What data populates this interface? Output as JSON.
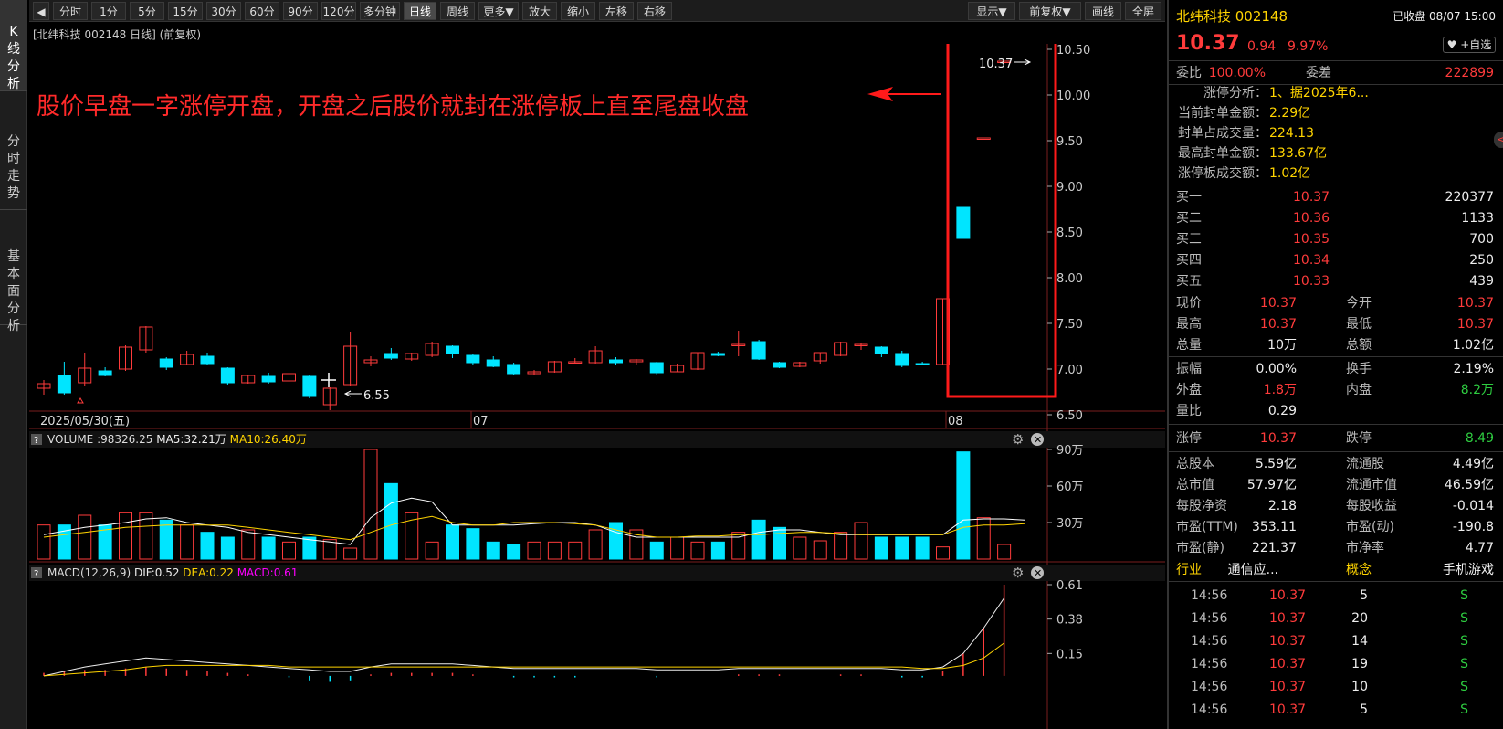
{
  "window": {
    "back_icon": "back-arrow-icon"
  },
  "toolbar": {
    "items": [
      "分时",
      "1分",
      "5分",
      "15分",
      "30分",
      "60分",
      "90分",
      "120分",
      "多分钟",
      "日线",
      "周线",
      "更多▼",
      "放大",
      "缩小",
      "左移",
      "右移"
    ],
    "active": "日线",
    "right_items": [
      "显示▼",
      "前复权▼",
      "画线",
      "全屏"
    ]
  },
  "side_tabs": [
    {
      "label": "K线分析",
      "active": true
    },
    {
      "label": "分时走势",
      "active": false
    },
    {
      "label": "基本面分析",
      "active": false
    }
  ],
  "kline": {
    "title": "[北纬科技 002148 日线]",
    "adjust": "(前复权)",
    "annotation": "股价早盘一字涨停开盘，开盘之后股价就封在涨停板上直至尾盘收盘",
    "high_label": "10.37",
    "low_label": "6.55",
    "date_label": "2025/05/30(五)",
    "month_labels": [
      "07",
      "08"
    ],
    "y_ticks": [
      "10.50",
      "10.00",
      "9.50",
      "9.00",
      "8.50",
      "8.00",
      "7.50",
      "7.00",
      "6.50"
    ]
  },
  "volume": {
    "label": "VOLUME",
    "value": ":98326.25",
    "ma5": "MA5:32.21万",
    "ma10": "MA10:26.40万",
    "y_ticks": [
      "90万",
      "60万",
      "30万"
    ]
  },
  "macd": {
    "label": "MACD(12,26,9)",
    "dif": "DIF:0.52",
    "dea": "DEA:0.22",
    "macd": "MACD:0.61",
    "y_ticks": [
      "0.61",
      "0.38",
      "0.15"
    ]
  },
  "chart_data": {
    "type": "candlestick",
    "candles": [
      [
        6.79,
        6.84,
        6.72,
        6.88
      ],
      [
        6.93,
        6.74,
        6.72,
        7.08
      ],
      [
        6.85,
        7.01,
        6.82,
        7.18
      ],
      [
        6.98,
        6.93,
        6.92,
        7.02
      ],
      [
        7.0,
        7.24,
        6.98,
        7.26
      ],
      [
        7.21,
        7.46,
        7.18,
        7.47
      ],
      [
        7.11,
        7.02,
        6.99,
        7.13
      ],
      [
        7.05,
        7.16,
        7.04,
        7.2
      ],
      [
        7.14,
        7.06,
        7.04,
        7.18
      ],
      [
        7.01,
        6.85,
        6.83,
        7.02
      ],
      [
        6.85,
        6.93,
        6.84,
        6.94
      ],
      [
        6.92,
        6.86,
        6.84,
        6.96
      ],
      [
        6.87,
        6.95,
        6.84,
        6.98
      ],
      [
        6.92,
        6.7,
        6.68,
        6.93
      ],
      [
        6.61,
        6.79,
        6.55,
        6.8
      ],
      [
        6.83,
        7.25,
        6.82,
        7.41
      ],
      [
        7.07,
        7.1,
        7.03,
        7.14
      ],
      [
        7.17,
        7.12,
        7.1,
        7.23
      ],
      [
        7.11,
        7.17,
        7.09,
        7.18
      ],
      [
        7.15,
        7.28,
        7.13,
        7.3
      ],
      [
        7.25,
        7.17,
        7.12,
        7.26
      ],
      [
        7.15,
        7.07,
        7.05,
        7.17
      ],
      [
        7.1,
        7.03,
        7.02,
        7.14
      ],
      [
        7.05,
        6.95,
        6.94,
        7.07
      ],
      [
        6.95,
        6.97,
        6.93,
        6.99
      ],
      [
        6.97,
        7.08,
        6.96,
        7.09
      ],
      [
        7.08,
        7.08,
        7.06,
        7.12
      ],
      [
        7.07,
        7.2,
        7.06,
        7.25
      ],
      [
        7.1,
        7.07,
        7.05,
        7.13
      ],
      [
        7.08,
        7.1,
        7.05,
        7.11
      ],
      [
        7.07,
        6.96,
        6.94,
        7.08
      ],
      [
        6.97,
        7.04,
        6.97,
        7.06
      ],
      [
        7.0,
        7.18,
        6.99,
        7.18
      ],
      [
        7.17,
        7.15,
        7.14,
        7.19
      ],
      [
        7.26,
        7.27,
        7.14,
        7.42
      ],
      [
        7.3,
        7.11,
        7.1,
        7.32
      ],
      [
        7.07,
        7.02,
        7.01,
        7.08
      ],
      [
        7.03,
        7.07,
        7.02,
        7.08
      ],
      [
        7.09,
        7.18,
        7.06,
        7.18
      ],
      [
        7.15,
        7.29,
        7.14,
        7.3
      ],
      [
        7.26,
        7.27,
        7.21,
        7.28
      ],
      [
        7.24,
        7.17,
        7.13,
        7.25
      ],
      [
        7.17,
        7.04,
        7.02,
        7.2
      ],
      [
        7.06,
        7.05,
        7.04,
        7.08
      ],
      [
        7.05,
        7.77,
        7.05,
        7.77
      ],
      [
        8.77,
        8.43,
        8.43,
        8.77
      ],
      [
        9.53,
        9.53,
        9.53,
        9.53
      ],
      [
        10.37,
        10.37,
        10.37,
        10.37
      ]
    ],
    "volume": [
      28,
      28,
      36,
      28,
      38,
      38,
      32,
      28,
      22,
      18,
      24,
      18,
      14,
      18,
      16,
      9,
      90,
      62,
      38,
      14,
      28,
      25,
      14,
      12,
      14,
      14,
      14,
      24,
      30,
      24,
      14,
      18,
      14,
      14,
      22,
      32,
      26,
      18,
      15,
      22,
      30,
      18,
      18,
      18,
      10,
      88,
      34,
      12,
      7
    ],
    "ma5": [
      20,
      23,
      26,
      28,
      30,
      33,
      34,
      30,
      28,
      26,
      22,
      20,
      18,
      16,
      14,
      12,
      34,
      46,
      50,
      47,
      28,
      28,
      28,
      28,
      29,
      30,
      30,
      28,
      22,
      18,
      18,
      18,
      18,
      18,
      18,
      22,
      24,
      24,
      22,
      20,
      20,
      20,
      20,
      20,
      20,
      32,
      33,
      33,
      32
    ],
    "ma10": [
      18,
      20,
      22,
      24,
      26,
      27,
      28,
      28,
      28,
      28,
      26,
      24,
      22,
      20,
      18,
      16,
      22,
      28,
      32,
      35,
      30,
      28,
      28,
      30,
      30,
      30,
      29,
      28,
      24,
      20,
      18,
      18,
      19,
      19,
      20,
      20,
      21,
      22,
      22,
      21,
      20,
      20,
      20,
      20,
      20,
      26,
      28,
      28,
      29
    ],
    "macd_hist": [
      0.02,
      0.03,
      0.04,
      0.04,
      0.05,
      0.06,
      0.05,
      0.04,
      0.03,
      0.02,
      0.01,
      0.0,
      -0.01,
      -0.03,
      -0.04,
      -0.03,
      0.01,
      0.02,
      0.02,
      0.02,
      0.02,
      0.01,
      0.0,
      -0.01,
      -0.01,
      -0.01,
      -0.01,
      0.0,
      0.0,
      0.0,
      -0.01,
      0.0,
      0.0,
      0.0,
      0.01,
      0.01,
      0.01,
      0.0,
      0.0,
      0.01,
      0.01,
      0.0,
      -0.01,
      -0.01,
      0.03,
      0.15,
      0.32,
      0.61
    ],
    "dif": [
      0.0,
      0.03,
      0.06,
      0.08,
      0.1,
      0.12,
      0.11,
      0.1,
      0.09,
      0.08,
      0.07,
      0.06,
      0.05,
      0.04,
      0.03,
      0.03,
      0.06,
      0.08,
      0.08,
      0.08,
      0.08,
      0.07,
      0.06,
      0.05,
      0.05,
      0.05,
      0.05,
      0.05,
      0.05,
      0.05,
      0.04,
      0.04,
      0.04,
      0.04,
      0.05,
      0.05,
      0.05,
      0.05,
      0.05,
      0.05,
      0.05,
      0.05,
      0.04,
      0.04,
      0.06,
      0.15,
      0.32,
      0.52
    ],
    "dea": [
      0.0,
      0.01,
      0.02,
      0.03,
      0.04,
      0.06,
      0.07,
      0.07,
      0.07,
      0.07,
      0.07,
      0.07,
      0.06,
      0.06,
      0.06,
      0.06,
      0.06,
      0.06,
      0.06,
      0.06,
      0.06,
      0.06,
      0.06,
      0.06,
      0.06,
      0.06,
      0.06,
      0.06,
      0.06,
      0.06,
      0.06,
      0.06,
      0.06,
      0.06,
      0.06,
      0.06,
      0.06,
      0.06,
      0.06,
      0.06,
      0.06,
      0.06,
      0.06,
      0.05,
      0.05,
      0.07,
      0.12,
      0.22
    ],
    "price_ylim": [
      6.5,
      10.5
    ],
    "vol_ylim": [
      0,
      90
    ],
    "macd_ylim": [
      -0.08,
      0.61
    ]
  },
  "colors": {
    "up": "#ff3b3b",
    "down": "#00e5ff",
    "ma5": "#ffffff",
    "ma10": "#ffd400",
    "dea": "#ffd400",
    "macd": "#ff00ff",
    "grid": "#7a1e1e"
  },
  "quote": {
    "name": "北纬科技 002148",
    "status": "已收盘 08/07 15:00",
    "price": "10.37",
    "change": "0.94",
    "pct": "9.97%",
    "watch_label": "+自选"
  },
  "order": {
    "weibi_label": "委比",
    "weibi": "100.00%",
    "weicha_label": "委差",
    "weicha": "222899"
  },
  "limit_info": [
    {
      "k": "涨停分析：",
      "v": "1、据2025年6..."
    },
    {
      "k": "当前封单金额：",
      "v": "2.29亿"
    },
    {
      "k": "封单占成交量：",
      "v": "224.13"
    },
    {
      "k": "最高封单金额：",
      "v": "133.67亿"
    },
    {
      "k": "涨停板成交额：",
      "v": "1.02亿"
    }
  ],
  "bids": [
    {
      "k": "买一",
      "p": "10.37",
      "q": "220377"
    },
    {
      "k": "买二",
      "p": "10.36",
      "q": "1133"
    },
    {
      "k": "买三",
      "p": "10.35",
      "q": "700"
    },
    {
      "k": "买四",
      "p": "10.34",
      "q": "250"
    },
    {
      "k": "买五",
      "p": "10.33",
      "q": "439"
    }
  ],
  "stats1": [
    {
      "k1": "现价",
      "v1": "10.37",
      "c1": "red",
      "k2": "今开",
      "v2": "10.37",
      "c2": "red"
    },
    {
      "k1": "最高",
      "v1": "10.37",
      "c1": "red",
      "k2": "最低",
      "v2": "10.37",
      "c2": "red"
    },
    {
      "k1": "总量",
      "v1": "10万",
      "c1": "wht",
      "k2": "总额",
      "v2": "1.02亿",
      "c2": "wht"
    }
  ],
  "stats2": [
    {
      "k1": "振幅",
      "v1": "0.00%",
      "c1": "wht",
      "k2": "换手",
      "v2": "2.19%",
      "c2": "wht"
    },
    {
      "k1": "外盘",
      "v1": "1.8万",
      "c1": "red",
      "k2": "内盘",
      "v2": "8.2万",
      "c2": "green"
    },
    {
      "k1": "量比",
      "v1": "0.29",
      "c1": "wht",
      "k2": "",
      "v2": "",
      "c2": "wht"
    }
  ],
  "stats3": [
    {
      "k1": "涨停",
      "v1": "10.37",
      "c1": "red",
      "k2": "跌停",
      "v2": "8.49",
      "c2": "green"
    }
  ],
  "stats4": [
    {
      "k1": "总股本",
      "v1": "5.59亿",
      "k2": "流通股",
      "v2": "4.49亿"
    },
    {
      "k1": "总市值",
      "v1": "57.97亿",
      "k2": "流通市值",
      "v2": "46.59亿"
    },
    {
      "k1": "每股净资",
      "v1": "2.18",
      "k2": "每股收益",
      "v2": "-0.014"
    },
    {
      "k1": "市盈(TTM)",
      "v1": "353.11",
      "k2": "市盈(动)",
      "v2": "-190.8"
    },
    {
      "k1": "市盈(静)",
      "v1": "221.37",
      "k2": "市净率",
      "v2": "4.77"
    }
  ],
  "industry": {
    "k1": "行业",
    "v1": "通信应...",
    "k2": "概念",
    "v2": "手机游戏"
  },
  "ticks": [
    {
      "t": "14:56",
      "p": "10.37",
      "v": "5",
      "s": "S"
    },
    {
      "t": "14:56",
      "p": "10.37",
      "v": "20",
      "s": "S"
    },
    {
      "t": "14:56",
      "p": "10.37",
      "v": "14",
      "s": "S"
    },
    {
      "t": "14:56",
      "p": "10.37",
      "v": "19",
      "s": "S"
    },
    {
      "t": "14:56",
      "p": "10.37",
      "v": "10",
      "s": "S"
    },
    {
      "t": "14:56",
      "p": "10.37",
      "v": "5",
      "s": "S"
    }
  ]
}
